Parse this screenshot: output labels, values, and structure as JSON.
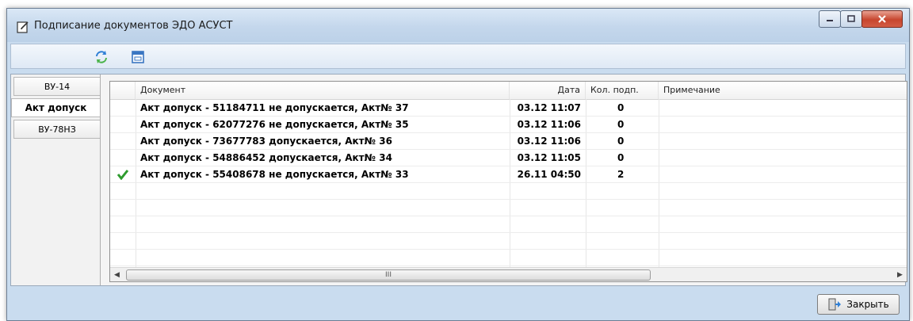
{
  "window": {
    "title": "Подписание документов ЭДО АСУСТ"
  },
  "toolbar": {
    "refresh_icon": "refresh-icon",
    "calendar_icon": "calendar-icon"
  },
  "tabs": [
    {
      "label": "ВУ-14"
    },
    {
      "label": "Акт допуск"
    },
    {
      "label": "ВУ-78НЗ"
    }
  ],
  "table": {
    "columns": {
      "document": "Документ",
      "date": "Дата",
      "signatures": "Кол. подп.",
      "note": "Примечание"
    },
    "rows": [
      {
        "signed": false,
        "document": "Акт допуск - 51184711 не допускается, Акт№ 37",
        "date": "03.12 11:07",
        "signatures": "0",
        "note": ""
      },
      {
        "signed": false,
        "document": "Акт допуск - 62077276 не допускается, Акт№ 35",
        "date": "03.12 11:06",
        "signatures": "0",
        "note": ""
      },
      {
        "signed": false,
        "document": "Акт допуск - 73677783  допускается, Акт№ 36",
        "date": "03.12 11:06",
        "signatures": "0",
        "note": ""
      },
      {
        "signed": false,
        "document": "Акт допуск - 54886452  допускается, Акт№ 34",
        "date": "03.12 11:05",
        "signatures": "0",
        "note": ""
      },
      {
        "signed": true,
        "document": "Акт допуск - 55408678 не допускается, Акт№ 33",
        "date": "26.11 04:50",
        "signatures": "2",
        "note": ""
      }
    ],
    "scroll_grip": "III"
  },
  "footer": {
    "close_label": "Закрыть"
  },
  "colors": {
    "check": "#2e9b2e",
    "accent": "#3a76c2"
  }
}
